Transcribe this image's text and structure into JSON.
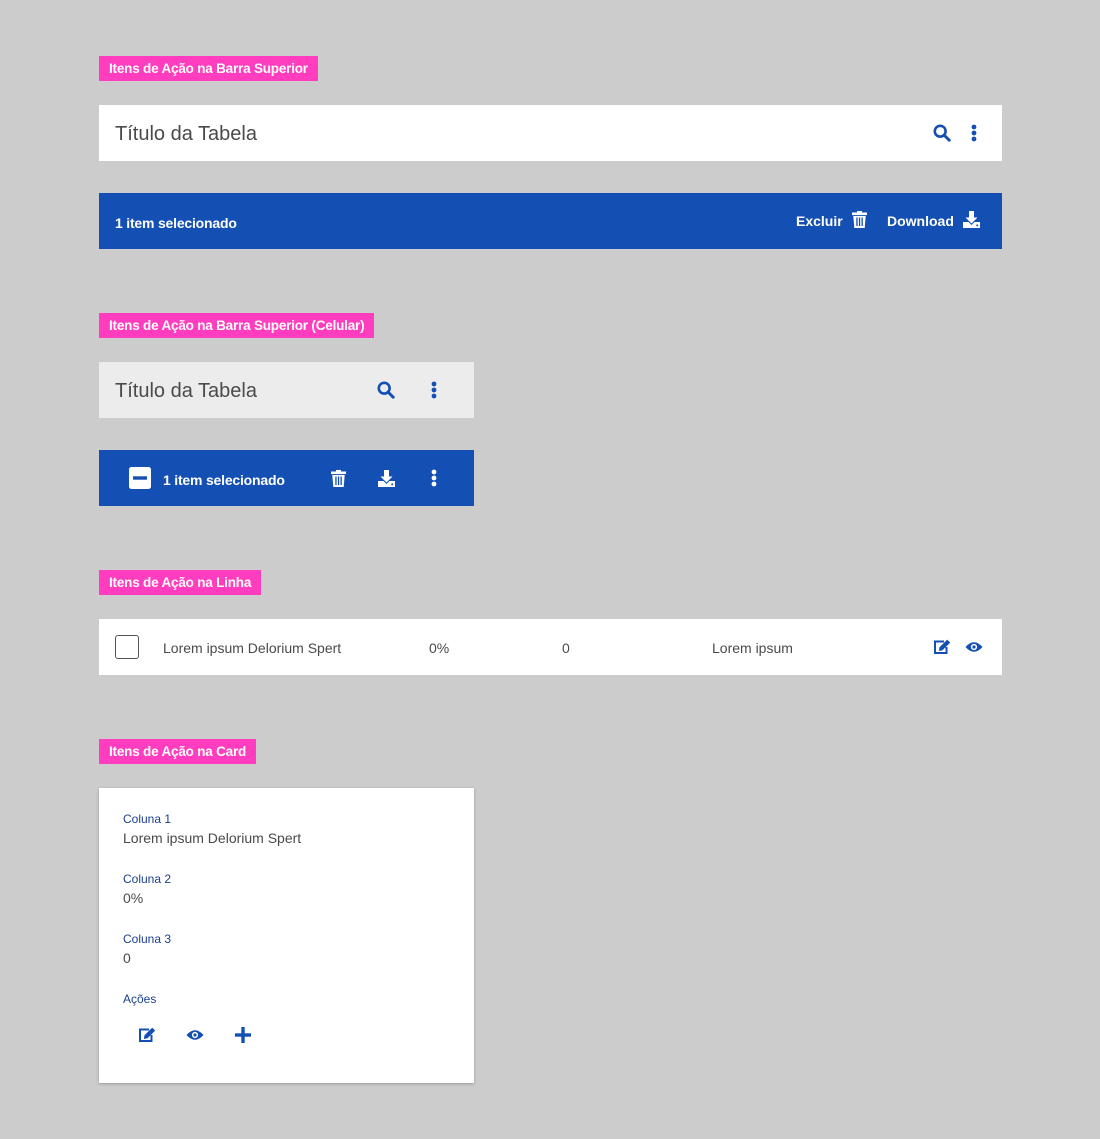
{
  "colors": {
    "accent": "#1450b4",
    "tag": "#ff3dbe",
    "background": "#cccccc"
  },
  "section1": {
    "tag": "Itens de Ação na Barra Superior",
    "table_title": "Título da Tabela",
    "icons": [
      "search-icon",
      "more-vertical-icon"
    ],
    "selection_bar": {
      "text": "1 item selecionado",
      "delete_label": "Excluir",
      "download_label": "Download"
    }
  },
  "section2": {
    "tag": "Itens de Ação na Barra Superior (Celular)",
    "table_title": "Título da Tabela",
    "icons": [
      "search-icon",
      "more-vertical-icon"
    ],
    "selection_bar": {
      "text": "1 item selecionado",
      "icons": [
        "minus-square-icon",
        "trash-icon",
        "download-icon",
        "more-vertical-icon"
      ]
    }
  },
  "section3": {
    "tag": "Itens de Ação na Linha",
    "row": {
      "col1": "Lorem ipsum Delorium Spert",
      "col2": "0%",
      "col3": "0",
      "col4": "Lorem ipsum"
    },
    "icons": [
      "edit-icon",
      "eye-icon"
    ]
  },
  "section4": {
    "tag": "Itens de Ação na Card",
    "card": {
      "fields": [
        {
          "label": "Coluna 1",
          "value": "Lorem ipsum Delorium Spert"
        },
        {
          "label": "Coluna 2",
          "value": "0%"
        },
        {
          "label": "Coluna 3",
          "value": "0"
        }
      ],
      "actions_label": "Ações",
      "icons": [
        "edit-icon",
        "eye-icon",
        "plus-icon"
      ]
    }
  }
}
